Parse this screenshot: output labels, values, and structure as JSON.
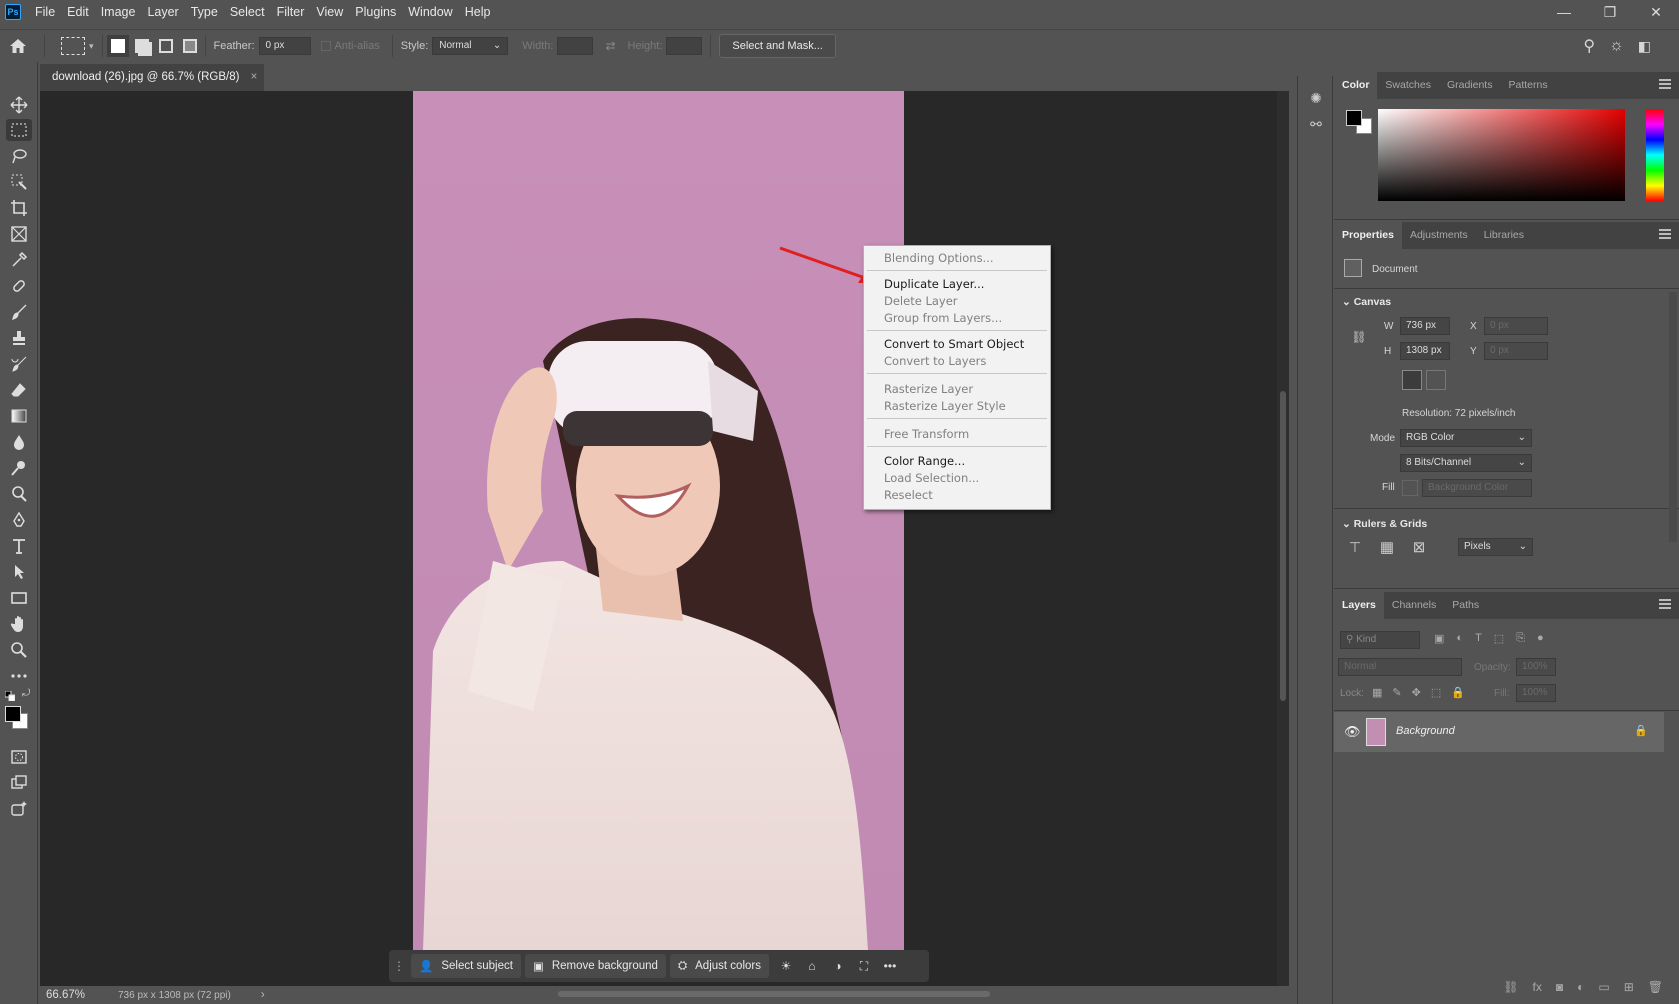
{
  "app": {
    "logo": "Ps"
  },
  "menu": [
    "File",
    "Edit",
    "Image",
    "Layer",
    "Type",
    "Select",
    "Filter",
    "View",
    "Plugins",
    "Window",
    "Help"
  ],
  "window_controls": {
    "minimize": "—",
    "restore": "❐",
    "close": "✕"
  },
  "options": {
    "feather_label": "Feather:",
    "feather_value": "0 px",
    "antialias_label": "Anti-alias",
    "style_label": "Style:",
    "style_value": "Normal",
    "width_label": "Width:",
    "height_label": "Height:",
    "select_mask_label": "Select and Mask..."
  },
  "document": {
    "tab_title": "download (26).jpg @ 66.7% (RGB/8)",
    "tab_close": "×",
    "zoom": "66.67%",
    "status_info": "736 px x 1308 px (72 ppi)"
  },
  "context_menu": [
    {
      "label": "Blending Options...",
      "enabled": false
    },
    {
      "label": "Duplicate Layer...",
      "enabled": true
    },
    {
      "label": "Delete Layer",
      "enabled": false
    },
    {
      "label": "Group from Layers...",
      "enabled": false
    },
    {
      "label": "Convert to Smart Object",
      "enabled": true
    },
    {
      "label": "Convert to Layers",
      "enabled": false
    },
    {
      "label": "Rasterize Layer",
      "enabled": false
    },
    {
      "label": "Rasterize Layer Style",
      "enabled": false
    },
    {
      "label": "Free Transform",
      "enabled": false
    },
    {
      "label": "Color Range...",
      "enabled": true
    },
    {
      "label": "Load Selection...",
      "enabled": false
    },
    {
      "label": "Reselect",
      "enabled": false
    }
  ],
  "taskbar": {
    "select_subject": "Select subject",
    "remove_background": "Remove background",
    "adjust_colors": "Adjust colors",
    "more": "•••"
  },
  "color_panel": {
    "tabs": [
      "Color",
      "Swatches",
      "Gradients",
      "Patterns"
    ],
    "active": "Color",
    "foreground": "#000000",
    "background": "#ffffff",
    "hue_color": "#e60000"
  },
  "properties_panel": {
    "tabs": [
      "Properties",
      "Adjustments",
      "Libraries"
    ],
    "active": "Properties",
    "doc_label": "Document",
    "canvas_title": "Canvas",
    "w_label": "W",
    "w_value": "736 px",
    "h_label": "H",
    "h_value": "1308 px",
    "x_label": "X",
    "x_placeholder": "0 px",
    "y_label": "Y",
    "y_placeholder": "0 px",
    "resolution": "Resolution: 72 pixels/inch",
    "mode_label": "Mode",
    "mode_value": "RGB Color",
    "bits_value": "8 Bits/Channel",
    "fill_label": "Fill",
    "fill_value": "Background Color",
    "rulers_title": "Rulers & Grids",
    "units_value": "Pixels"
  },
  "layers_panel": {
    "tabs": [
      "Layers",
      "Channels",
      "Paths"
    ],
    "active": "Layers",
    "kind_placeholder": "Kind",
    "blend_mode": "Normal",
    "opacity_label": "Opacity:",
    "opacity_value": "100%",
    "lock_label": "Lock:",
    "fill_label": "Fill:",
    "fill_value": "100%",
    "layers": [
      {
        "name": "Background",
        "visible": true,
        "locked": true
      }
    ]
  },
  "colors": {
    "canvas_pink": "#c28fb3",
    "annotation_arrow": "#e02020",
    "ps_blue": "#31a8ff"
  }
}
